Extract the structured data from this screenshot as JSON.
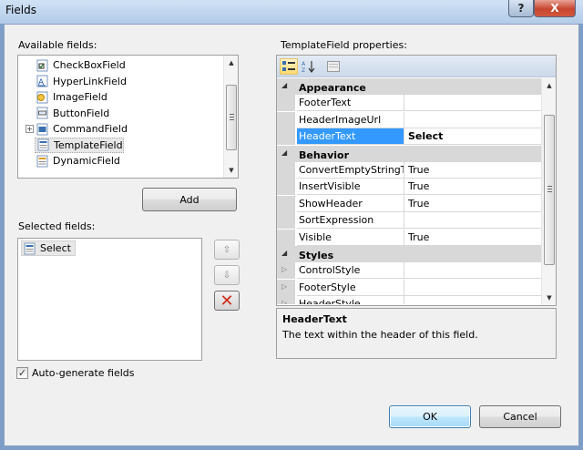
{
  "window": {
    "title": "Fields",
    "help_label": "?",
    "close_label": "X"
  },
  "available": {
    "label": "Available fields:",
    "items": [
      {
        "label": "CheckBoxField",
        "icon": "checkbox-field-icon"
      },
      {
        "label": "HyperLinkField",
        "icon": "hyperlink-field-icon"
      },
      {
        "label": "ImageField",
        "icon": "image-field-icon"
      },
      {
        "label": "ButtonField",
        "icon": "button-field-icon"
      },
      {
        "label": "CommandField",
        "icon": "command-field-icon",
        "expandable": true
      },
      {
        "label": "TemplateField",
        "icon": "template-field-icon",
        "highlighted": true
      },
      {
        "label": "DynamicField",
        "icon": "dynamic-field-icon"
      }
    ],
    "add_label": "Add"
  },
  "selected": {
    "label": "Selected fields:",
    "items": [
      {
        "label": "Select",
        "icon": "template-field-icon"
      }
    ]
  },
  "auto_generate": {
    "label": "Auto-generate fields",
    "checked": true
  },
  "properties": {
    "label": "TemplateField properties:",
    "rows": [
      {
        "type": "category",
        "name": "Appearance"
      },
      {
        "type": "prop",
        "name": "FooterText",
        "value": ""
      },
      {
        "type": "prop",
        "name": "HeaderImageUrl",
        "value": ""
      },
      {
        "type": "prop",
        "name": "HeaderText",
        "value": "Select",
        "selected": true
      },
      {
        "type": "category",
        "name": "Behavior"
      },
      {
        "type": "prop",
        "name": "ConvertEmptyStringToNull",
        "value": "True"
      },
      {
        "type": "prop",
        "name": "InsertVisible",
        "value": "True"
      },
      {
        "type": "prop",
        "name": "ShowHeader",
        "value": "True"
      },
      {
        "type": "prop",
        "name": "SortExpression",
        "value": ""
      },
      {
        "type": "prop",
        "name": "Visible",
        "value": "True"
      },
      {
        "type": "category",
        "name": "Styles"
      },
      {
        "type": "prop",
        "name": "ControlStyle",
        "value": "",
        "expandable": true
      },
      {
        "type": "prop",
        "name": "FooterStyle",
        "value": "",
        "expandable": true
      },
      {
        "type": "prop",
        "name": "HeaderStyle",
        "value": "",
        "expandable": true
      }
    ],
    "description": {
      "title": "HeaderText",
      "text": "The text within the header of this field."
    }
  },
  "buttons": {
    "ok": "OK",
    "cancel": "Cancel"
  }
}
